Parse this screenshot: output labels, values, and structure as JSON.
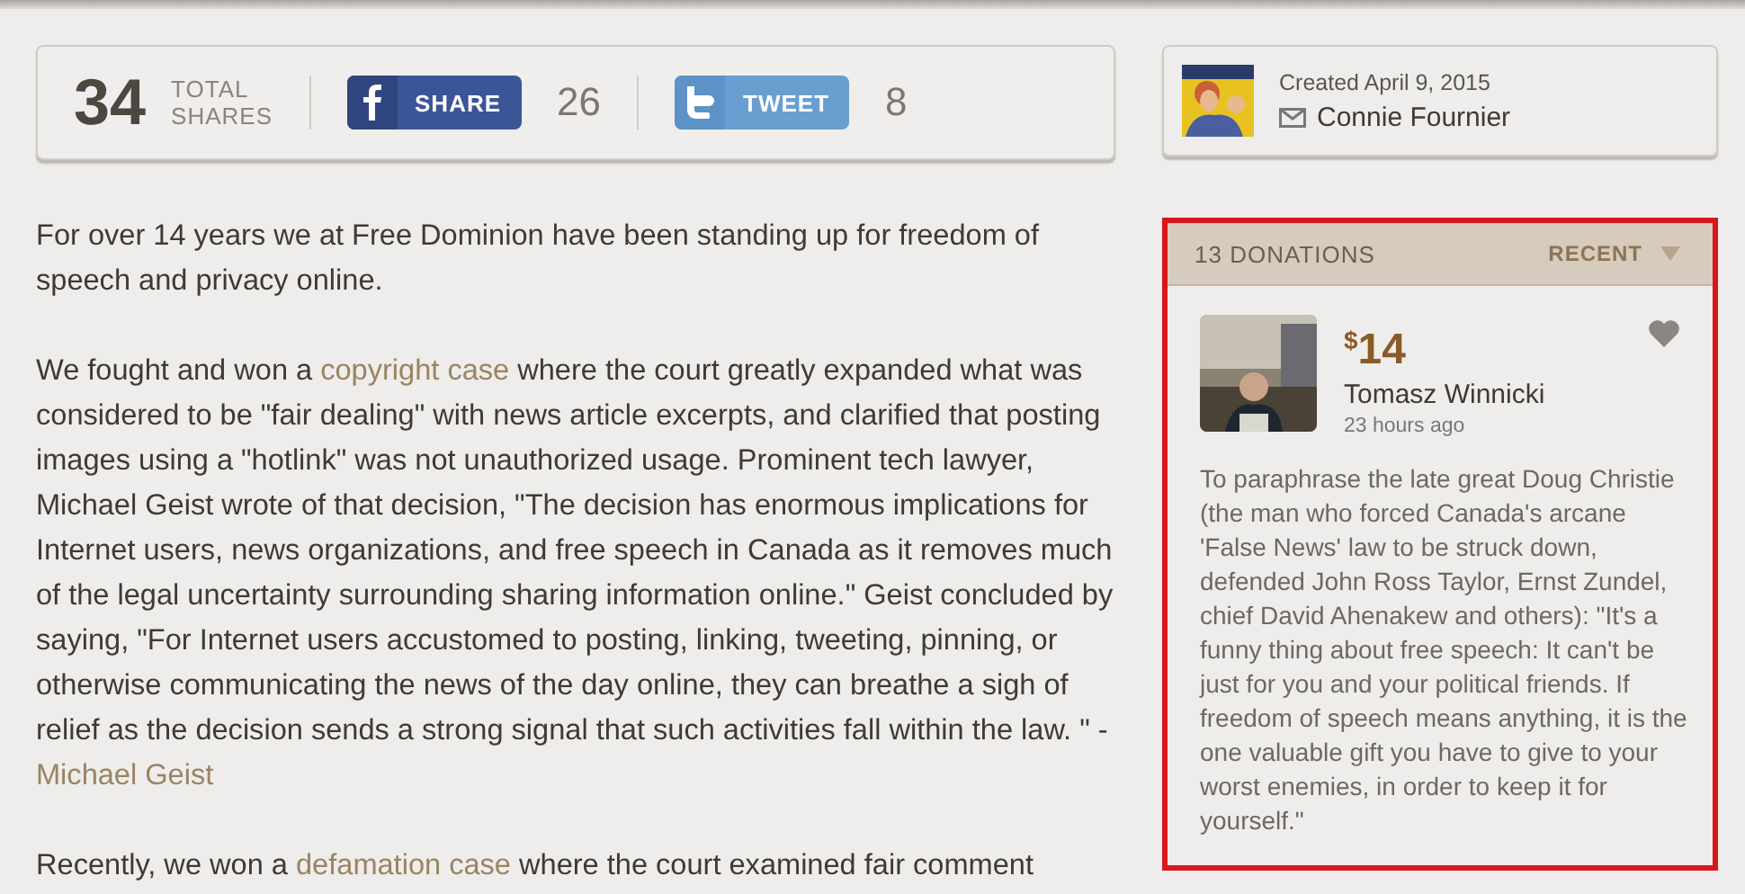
{
  "share_bar": {
    "total": "34",
    "total_label": [
      "TOTAL",
      "SHARES"
    ],
    "buttons": [
      {
        "kind": "facebook",
        "label": "SHARE",
        "count": "26"
      },
      {
        "kind": "twitter",
        "label": "TWEET",
        "count": "8"
      }
    ]
  },
  "article": {
    "paragraphs": [
      [
        {
          "text": "For over 14 years we at Free Dominion have been standing up for freedom of speech and privacy online.",
          "link": false
        }
      ],
      [
        {
          "text": "We fought and won a ",
          "link": false
        },
        {
          "text": "copyright case",
          "link": true
        },
        {
          "text": " where the court greatly expanded what was considered to be \"fair dealing\" with news article excerpts, and clarified that posting images using a \"hotlink\" was not unauthorized usage.  Prominent tech lawyer, Michael Geist wrote of that decision, \"The decision has enormous implications for Internet users, news organizations, and free speech in Canada as it removes much of the legal uncertainty surrounding sharing information online.\" Geist concluded by saying, \"For Internet users accustomed to posting, linking, tweeting, pinning, or otherwise communicating the news of the day online, they can breathe a sigh of relief as the decision sends a strong signal that such activities fall within the law. \" - ",
          "link": false
        },
        {
          "text": "Michael Geist",
          "link": true
        }
      ],
      [
        {
          "text": "Recently, we won a ",
          "link": false
        },
        {
          "text": "defamation case",
          "link": true
        },
        {
          "text": " where the court examined fair comment",
          "link": false
        }
      ]
    ]
  },
  "campaign": {
    "created": "Created April 9, 2015",
    "organizer": "Connie Fournier"
  },
  "donations": {
    "count": "13 DONATIONS",
    "sort": "RECENT",
    "items": [
      {
        "amount_symbol": "$",
        "amount": "14",
        "name": "Tomasz Winnicki",
        "time": "23 hours ago",
        "liked": false,
        "comment": "To paraphrase the late great Doug Christie (the man who forced Canada's arcane 'False News' law to be struck down, defended John Ross Taylor, Ernst Zundel, chief David Ahenakew and others): \"It's a funny thing about free speech: It can't be just for you and your political friends. If freedom of speech means anything, it is the one valuable gift you have to give to your worst enemies, in order to keep it for yourself.\""
      }
    ]
  }
}
